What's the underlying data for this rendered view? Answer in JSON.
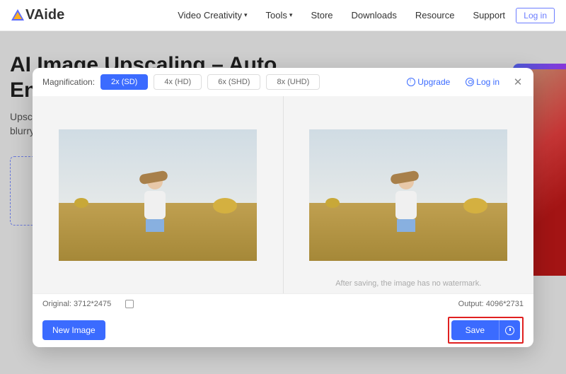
{
  "header": {
    "logo": "VAide",
    "nav": [
      "Video Creativity",
      "Tools",
      "Store",
      "Downloads",
      "Resource",
      "Support"
    ],
    "login": "Log in"
  },
  "page": {
    "title_line1": "AI Image Upscaling – Auto",
    "title_line2": "Enla",
    "subtitle_line1": "Upscal",
    "subtitle_line2": "blurry"
  },
  "modal": {
    "magnification_label": "Magnification:",
    "mag_options": [
      "2x (SD)",
      "4x (HD)",
      "6x (SHD)",
      "8x (UHD)"
    ],
    "upgrade": "Upgrade",
    "login": "Log in",
    "watermark_note": "After saving, the image has no watermark.",
    "original_label": "Original: 3712*2475",
    "output_label": "Output: 4096*2731",
    "new_image": "New Image",
    "save": "Save"
  }
}
